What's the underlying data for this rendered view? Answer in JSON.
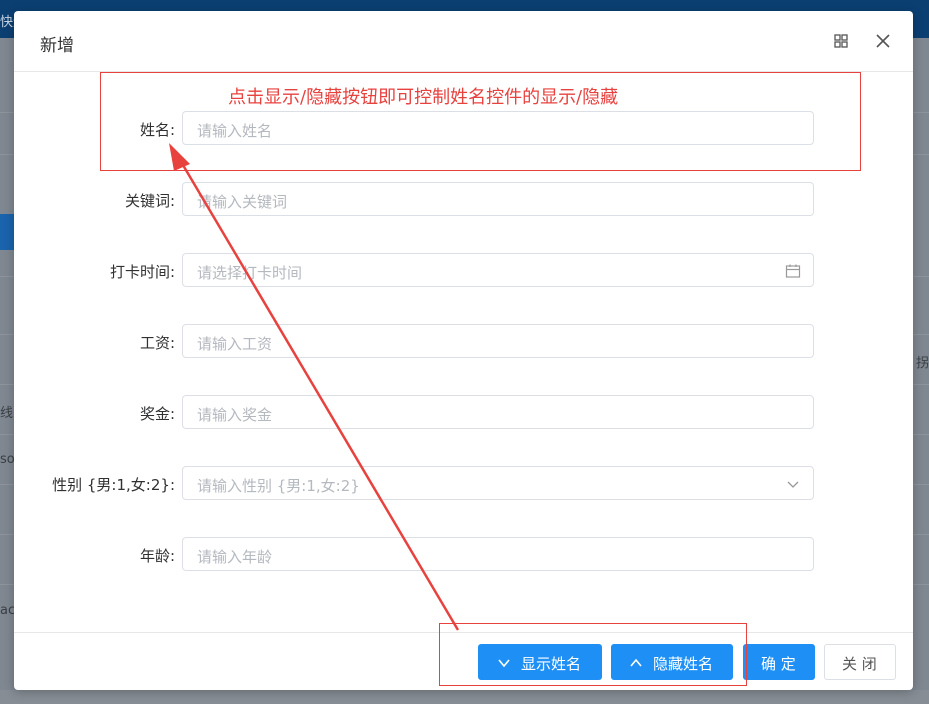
{
  "background": {
    "topbar_text": "快速",
    "left_fragments": [
      "线",
      "so",
      "ac"
    ],
    "right_fragment": "拐"
  },
  "dialog": {
    "title": "新增",
    "maximize_icon": "grid-icon",
    "close_icon": "close-icon"
  },
  "annotation": {
    "text": "点击显示/隐藏按钮即可控制姓名控件的显示/隐藏",
    "color": "#e8423f"
  },
  "form": {
    "fields": [
      {
        "label": "姓名:",
        "placeholder": "请输入姓名"
      },
      {
        "label": "关键词:",
        "placeholder": "请输入关键词"
      },
      {
        "label": "打卡时间:",
        "placeholder": "请选择打卡时间",
        "icon": "calendar-icon"
      },
      {
        "label": "工资:",
        "placeholder": "请输入工资"
      },
      {
        "label": "奖金:",
        "placeholder": "请输入奖金"
      },
      {
        "label": "性别 {男:1,女:2}:",
        "placeholder": "请输入性别 {男:1,女:2}",
        "icon": "chevron-down-icon"
      },
      {
        "label": "年龄:",
        "placeholder": "请输入年龄"
      }
    ]
  },
  "footer": {
    "show_name_label": "显示姓名",
    "hide_name_label": "隐藏姓名",
    "confirm_label": "确 定",
    "close_label": "关 闭"
  },
  "colors": {
    "primary": "#1e90f5",
    "annotation": "#e8423f",
    "topbar": "#0b3f72"
  }
}
